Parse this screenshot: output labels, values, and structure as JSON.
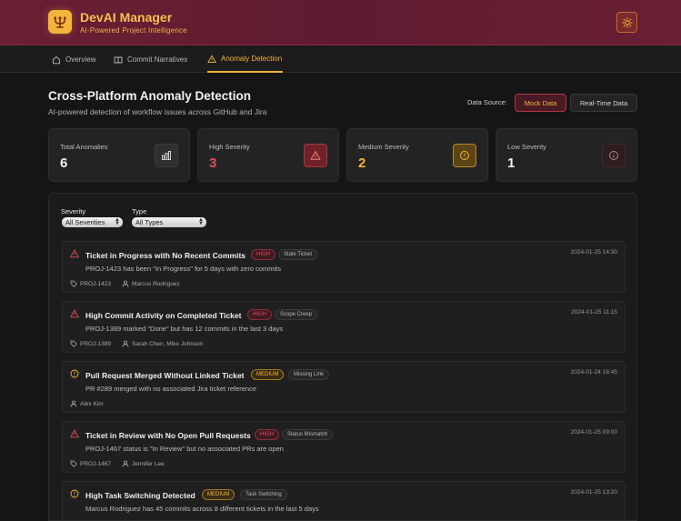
{
  "app": {
    "title": "DevAI Manager",
    "subtitle": "AI-Powered Project Intelligence"
  },
  "nav": {
    "tabs": [
      {
        "label": "Overview",
        "icon": "home-icon",
        "active": false
      },
      {
        "label": "Commit Narratives",
        "icon": "book-icon",
        "active": false
      },
      {
        "label": "Anomaly Detection",
        "icon": "warning-icon",
        "active": true
      }
    ]
  },
  "page": {
    "title": "Cross-Platform Anomaly Detection",
    "subtitle": "AI-powered detection of workflow issues across GitHub and Jira"
  },
  "data_source": {
    "label": "Data Source:",
    "options": [
      "Mock Data",
      "Real-Time Data"
    ],
    "selected": "Mock Data"
  },
  "stats": [
    {
      "label": "Total Anomalies",
      "value": "6",
      "icon": "bar-chart-icon",
      "color": "#f2f2f2"
    },
    {
      "label": "High Severity",
      "value": "3",
      "icon": "alert-triangle-icon",
      "color": "#e04d5b"
    },
    {
      "label": "Medium Severity",
      "value": "2",
      "icon": "alert-circle-icon",
      "color": "#f2b43a"
    },
    {
      "label": "Low Severity",
      "value": "1",
      "icon": "info-icon",
      "color": "#f2f2f2"
    }
  ],
  "filters": {
    "severity": {
      "label": "Severity",
      "value": "All Severities"
    },
    "type": {
      "label": "Type",
      "value": "All Types"
    }
  },
  "anomalies": [
    {
      "title": "Ticket in Progress with No Recent Commits",
      "severity": "HIGH",
      "type": "Stale Ticket",
      "time": "2024-01-25 14:30",
      "description": "PROJ-1423 has been \"In Progress\" for 5 days with zero commits",
      "ticket": "PROJ-1423",
      "people": "Marcus Rodriguez"
    },
    {
      "title": "High Commit Activity on Completed Ticket",
      "severity": "HIGH",
      "type": "Scope Creep",
      "time": "2024-01-25 11:15",
      "description": "PROJ-1389 marked \"Done\" but has 12 commits in the last 3 days",
      "ticket": "PROJ-1389",
      "people": "Sarah Chen, Mike Johnson"
    },
    {
      "title": "Pull Request Merged Without Linked Ticket",
      "severity": "MEDIUM",
      "type": "Missing Link",
      "time": "2024-01-24 16:45",
      "description": "PR #289 merged with no associated Jira ticket reference",
      "ticket": "",
      "people": "Alex Kim"
    },
    {
      "title": "Ticket in Review with No Open Pull Requests",
      "severity": "HIGH",
      "type": "Status Mismatch",
      "time": "2024-01-25 09:00",
      "description": "PROJ-1467 status is \"In Review\" but no associated PRs are open",
      "ticket": "PROJ-1467",
      "people": "Jennifer Lee"
    },
    {
      "title": "High Task Switching Detected",
      "severity": "MEDIUM",
      "type": "Task Switching",
      "time": "2024-01-25 13:20",
      "description": "Marcus Rodriguez has 45 commits across 8 different tickets in the last 5 days",
      "ticket": "",
      "people": ""
    }
  ],
  "colors": {
    "accent": "#f2b43a",
    "high": "#e04d5b",
    "header": "#6a1f33"
  }
}
